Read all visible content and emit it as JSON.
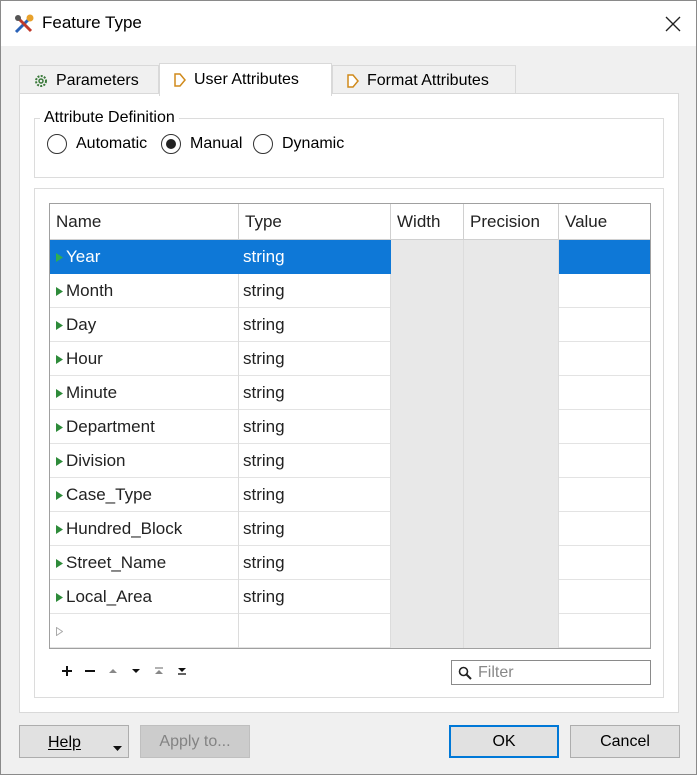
{
  "window": {
    "title": "Feature Type"
  },
  "tabs": [
    {
      "label": "Parameters",
      "icon": "gear-icon"
    },
    {
      "label": "User Attributes",
      "icon": "arrow-tag-icon"
    },
    {
      "label": "Format Attributes",
      "icon": "arrow-tag-icon"
    }
  ],
  "attribute_definition": {
    "title": "Attribute Definition",
    "options": [
      "Automatic",
      "Manual",
      "Dynamic"
    ],
    "selected": "Manual"
  },
  "table": {
    "headers": [
      "Name",
      "Type",
      "Width",
      "Precision",
      "Value"
    ],
    "rows": [
      {
        "name": "Year",
        "type": "string"
      },
      {
        "name": "Month",
        "type": "string"
      },
      {
        "name": "Day",
        "type": "string"
      },
      {
        "name": "Hour",
        "type": "string"
      },
      {
        "name": "Minute",
        "type": "string"
      },
      {
        "name": "Department",
        "type": "string"
      },
      {
        "name": "Division",
        "type": "string"
      },
      {
        "name": "Case_Type",
        "type": "string"
      },
      {
        "name": "Hundred_Block",
        "type": "string"
      },
      {
        "name": "Street_Name",
        "type": "string"
      },
      {
        "name": "Local_Area",
        "type": "string"
      }
    ],
    "selected_row": "Year"
  },
  "filter": {
    "placeholder": "Filter"
  },
  "buttons": {
    "help": "Help",
    "apply": "Apply to...",
    "ok": "OK",
    "cancel": "Cancel"
  },
  "colors": {
    "selection": "#0e78d7",
    "default_button_border": "#0078d7"
  }
}
